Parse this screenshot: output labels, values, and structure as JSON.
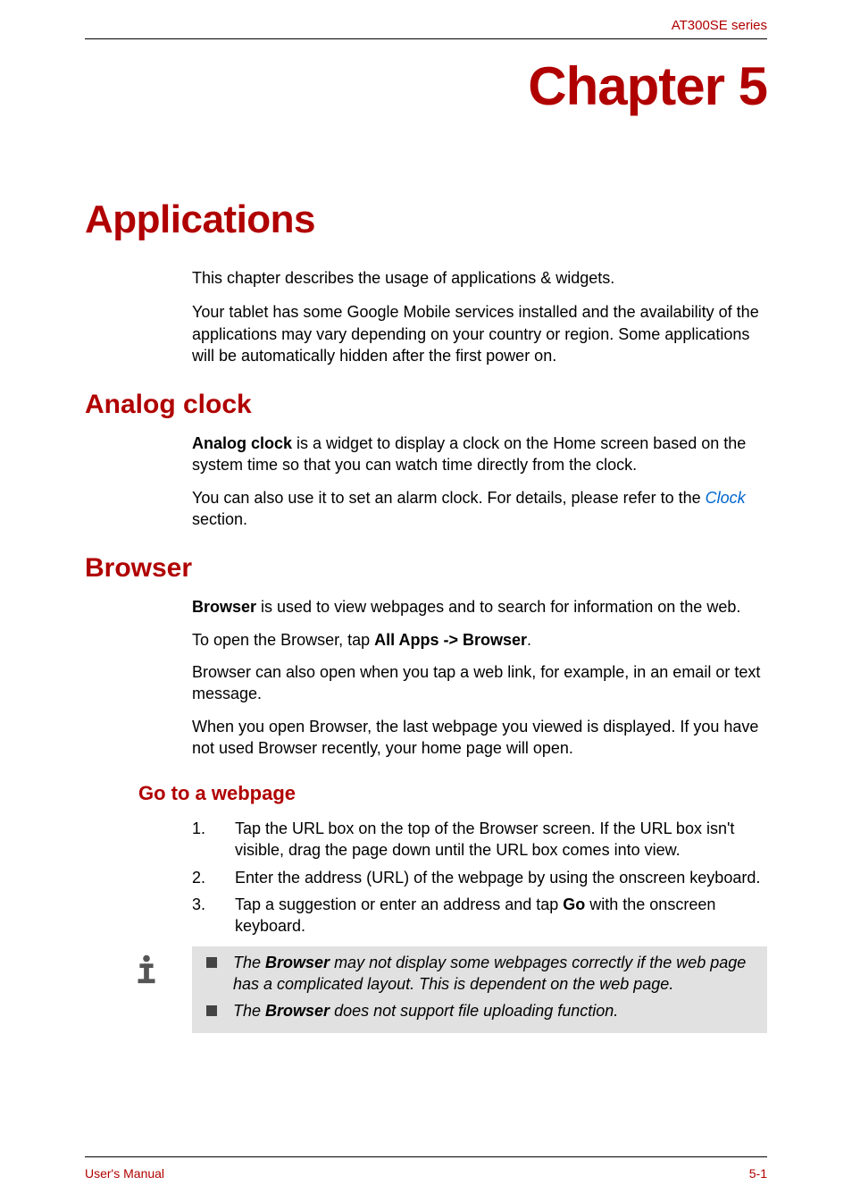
{
  "header": {
    "series": "AT300SE series"
  },
  "chapter": {
    "label": "Chapter 5",
    "title": "Applications"
  },
  "intro": {
    "p1": "This chapter describes the usage of applications & widgets.",
    "p2": "Your tablet has some Google Mobile services installed and the availability of the applications may vary depending on your country or region. Some applications will be automatically hidden after the first power on."
  },
  "analog_clock": {
    "heading": "Analog clock",
    "p1_bold": "Analog clock",
    "p1_rest": " is a widget to display a clock on the Home screen based on the system time so that you can watch time directly from the clock.",
    "p2_pre": "You can also use it to set an alarm clock. For details, please refer to the ",
    "p2_link": "Clock",
    "p2_post": " section."
  },
  "browser": {
    "heading": "Browser",
    "p1_bold": "Browser",
    "p1_rest": " is used to view webpages and to search for information on the web.",
    "p2_pre": "To open the Browser, tap ",
    "p2_bold": "All Apps -> Browser",
    "p2_post": ".",
    "p3": "Browser can also open when you tap a web link, for example, in an email or text message.",
    "p4": "When you open Browser, the last webpage you viewed is displayed. If you have not used Browser recently, your home page will open."
  },
  "goto_webpage": {
    "heading": "Go to a webpage",
    "steps": [
      "Tap the URL box on the top of the Browser screen. If the URL box isn't visible, drag the page down until the URL box comes into view.",
      "Enter the address (URL) of the webpage by using the onscreen keyboard."
    ],
    "step3_pre": "Tap a suggestion or enter an address and tap ",
    "step3_bold": "Go",
    "step3_post": " with the onscreen keyboard.",
    "notes": {
      "n1_pre": "The ",
      "n1_bold": "Browser",
      "n1_post": " may not display some webpages correctly if the web page has a complicated layout. This is dependent on the web page.",
      "n2_pre": "The ",
      "n2_bold": "Browser",
      "n2_post": " does not support file uploading function."
    }
  },
  "footer": {
    "left": "User's Manual",
    "right": "5-1"
  }
}
